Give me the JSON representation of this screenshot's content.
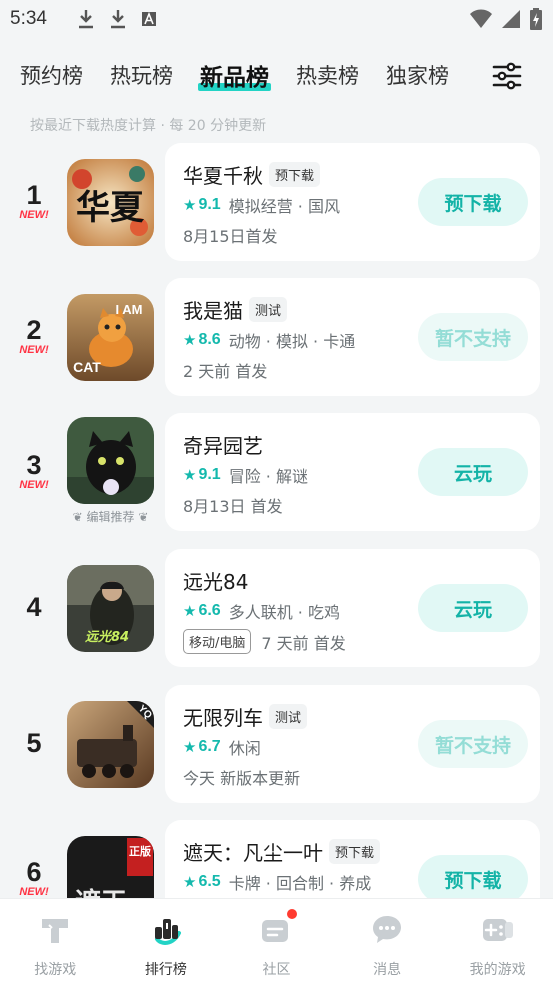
{
  "status_bar": {
    "time": "5:34",
    "left_icons": [
      "download-icon",
      "download-icon",
      "font-icon"
    ],
    "right_icons": [
      "wifi-icon",
      "signal-icon",
      "battery-icon"
    ]
  },
  "tabs": [
    {
      "label": "预约榜",
      "active": false
    },
    {
      "label": "热玩榜",
      "active": false
    },
    {
      "label": "新品榜",
      "active": true
    },
    {
      "label": "热卖榜",
      "active": false
    },
    {
      "label": "独家榜",
      "active": false
    }
  ],
  "subtitle": "按最近下载热度计算 · 每 20 分钟更新",
  "games": [
    {
      "rank": "1",
      "new_badge": "NEW!",
      "title": "华夏千秋",
      "tag": "预下载",
      "score": "9.1",
      "genre": "模拟经营 · 国风",
      "platform": "",
      "date": "8月15日首发",
      "action": "预下载",
      "action_disabled": false,
      "editor_tag": ""
    },
    {
      "rank": "2",
      "new_badge": "NEW!",
      "title": "我是猫",
      "tag": "测试",
      "score": "8.6",
      "genre": "动物 · 模拟 · 卡通",
      "platform": "",
      "date": "2 天前 首发",
      "action": "暂不支持",
      "action_disabled": true,
      "editor_tag": ""
    },
    {
      "rank": "3",
      "new_badge": "NEW!",
      "title": "奇异园艺",
      "tag": "",
      "score": "9.1",
      "genre": "冒险 · 解谜",
      "platform": "",
      "date": "8月13日 首发",
      "action": "云玩",
      "action_disabled": false,
      "editor_tag": "编辑推荐"
    },
    {
      "rank": "4",
      "new_badge": "",
      "title": "远光84",
      "tag": "",
      "score": "6.6",
      "genre": "多人联机 · 吃鸡",
      "platform": "移动/电脑",
      "date": "7 天前 首发",
      "action": "云玩",
      "action_disabled": false,
      "editor_tag": ""
    },
    {
      "rank": "5",
      "new_badge": "",
      "title": "无限列车",
      "tag": "测试",
      "score": "6.7",
      "genre": "休闲",
      "platform": "",
      "date": "今天 新版本更新",
      "action": "暂不支持",
      "action_disabled": true,
      "editor_tag": ""
    },
    {
      "rank": "6",
      "new_badge": "NEW!",
      "title": "遮天：凡尘一叶",
      "tag": "预下载",
      "score": "6.5",
      "genre": "卡牌 · 回合制 · 养成",
      "platform": "",
      "date": "",
      "action": "预下载",
      "action_disabled": false,
      "editor_tag": ""
    }
  ],
  "icon_texts": {
    "g1": "华夏",
    "g2_top": "I AM",
    "g2_bottom": "CAT",
    "g4": "远光84",
    "g5": "YQ",
    "g6_badge": "正版",
    "g6": "遮天"
  },
  "bottom_nav": [
    {
      "label": "找游戏",
      "icon": "hammer-icon",
      "active": false
    },
    {
      "label": "排行榜",
      "icon": "ranking-icon",
      "active": true
    },
    {
      "label": "社区",
      "icon": "community-icon",
      "active": false
    },
    {
      "label": "消息",
      "icon": "message-icon",
      "active": false
    },
    {
      "label": "我的游戏",
      "icon": "gamepad-icon",
      "active": false
    }
  ],
  "colors": {
    "accent": "#14b3a7",
    "highlight": "#22d3c5",
    "new_red": "#ff3344"
  }
}
